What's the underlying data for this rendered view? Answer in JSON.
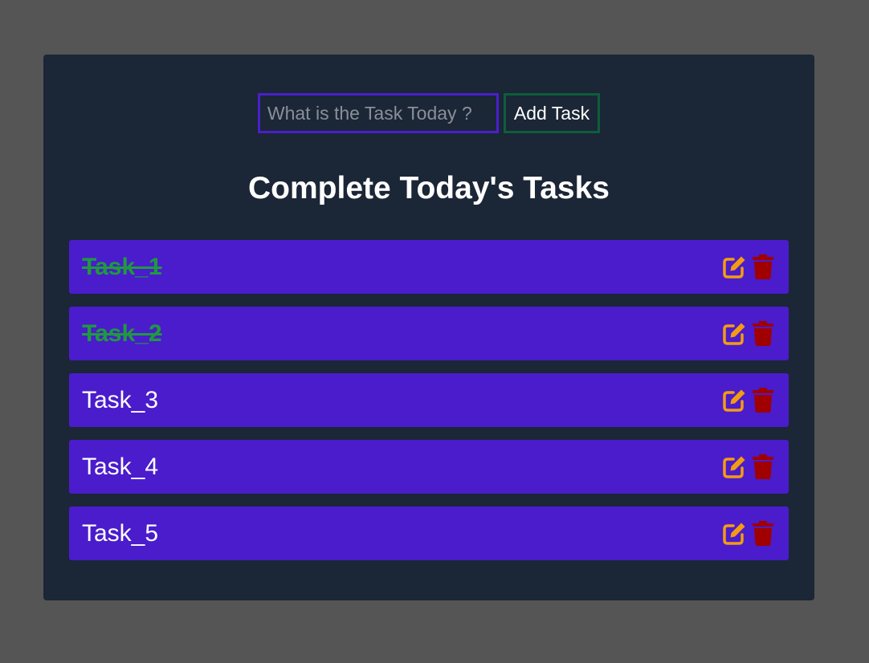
{
  "form": {
    "input_placeholder": "What is the Task Today ?",
    "input_value": "",
    "add_button_label": "Add Task"
  },
  "heading": "Complete Today's Tasks",
  "tasks": [
    {
      "label": "Task_1",
      "completed": true
    },
    {
      "label": "Task_2",
      "completed": true
    },
    {
      "label": "Task_3",
      "completed": false
    },
    {
      "label": "Task_4",
      "completed": false
    },
    {
      "label": "Task_5",
      "completed": false
    }
  ],
  "icons": {
    "edit": "edit-icon",
    "delete": "trash-icon"
  },
  "colors": {
    "page_background": "#555555",
    "panel_background": "#1b2636",
    "task_background": "#4a1ccc",
    "completed_text": "#1e9a3e",
    "edit_icon": "#f39c12",
    "delete_icon": "#a00000",
    "input_border": "#4a1fcc",
    "button_border": "#0d5e3a"
  }
}
